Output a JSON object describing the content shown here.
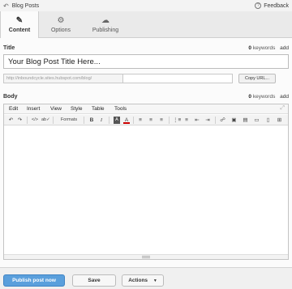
{
  "topbar": {
    "back_label": "Blog Posts",
    "feedback_label": "Feedback"
  },
  "tabs": [
    {
      "label": "Content",
      "icon": "pencil-icon",
      "active": true
    },
    {
      "label": "Options",
      "icon": "gear-icon",
      "active": false
    },
    {
      "label": "Publishing",
      "icon": "cloud-icon",
      "active": false
    }
  ],
  "title_section": {
    "heading": "Title",
    "keywords_count": "0",
    "keywords_label": "keywords",
    "add_label": "add",
    "title_value": "Your Blog Post Title Here...",
    "url_prefix": "http://inboundcycle.sites.hubspot.com/blog/",
    "url_value": "",
    "copy_url_label": "Copy URL..."
  },
  "body_section": {
    "heading": "Body",
    "keywords_count": "0",
    "keywords_label": "keywords",
    "add_label": "add"
  },
  "editor": {
    "menus": [
      "Edit",
      "Insert",
      "View",
      "Style",
      "Table",
      "Tools"
    ],
    "formats_label": "Formats"
  },
  "footer": {
    "publish_label": "Publish post now",
    "save_label": "Save",
    "actions_label": "Actions"
  },
  "colors": {
    "primary_button": "#5a9fdc",
    "background": "#fbfbfb"
  }
}
